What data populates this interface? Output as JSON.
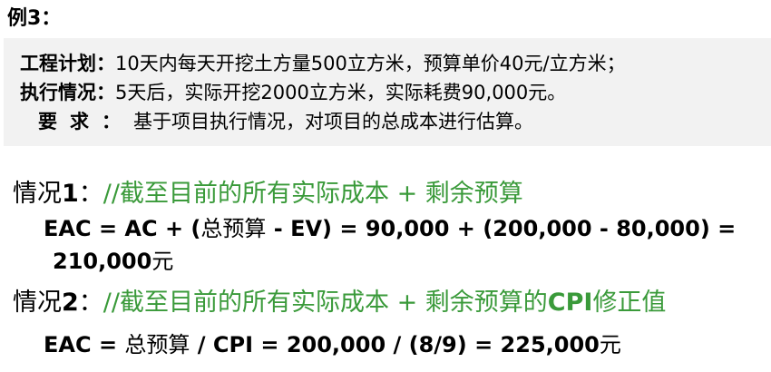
{
  "example_title": "例3：",
  "plan": {
    "label": "工程计划：",
    "text": "10天内每天开挖土方量500立方米，预算单价40元/立方米；"
  },
  "status": {
    "label": "执行情况：",
    "text": "5天后，实际开挖2000立方米，实际耗费90,000元。"
  },
  "requirement": {
    "label": "要求：",
    "text": "基于项目执行情况，对项目的总成本进行估算。"
  },
  "case1": {
    "prefix": "情况",
    "number": "1",
    "colon": "：",
    "comment": "//截至目前的所有实际成本 + 剩余预算",
    "formula_a": "EAC = AC + (",
    "formula_b": "总预算",
    "formula_c": " - EV) = 90,000 + (200,000 - 80,000) =",
    "result_num": "210,000",
    "result_unit": "元"
  },
  "case2": {
    "prefix": "情况",
    "number": "2",
    "colon": "：",
    "comment_a": "//截至目前的所有实际成本 + 剩余预算的",
    "comment_b": "CPI",
    "comment_c": "修正值",
    "formula_a": "EAC = ",
    "formula_b": "总预算",
    "formula_c": " / CPI = 200,000 / (8/9) = 225,000",
    "formula_d": "元"
  }
}
